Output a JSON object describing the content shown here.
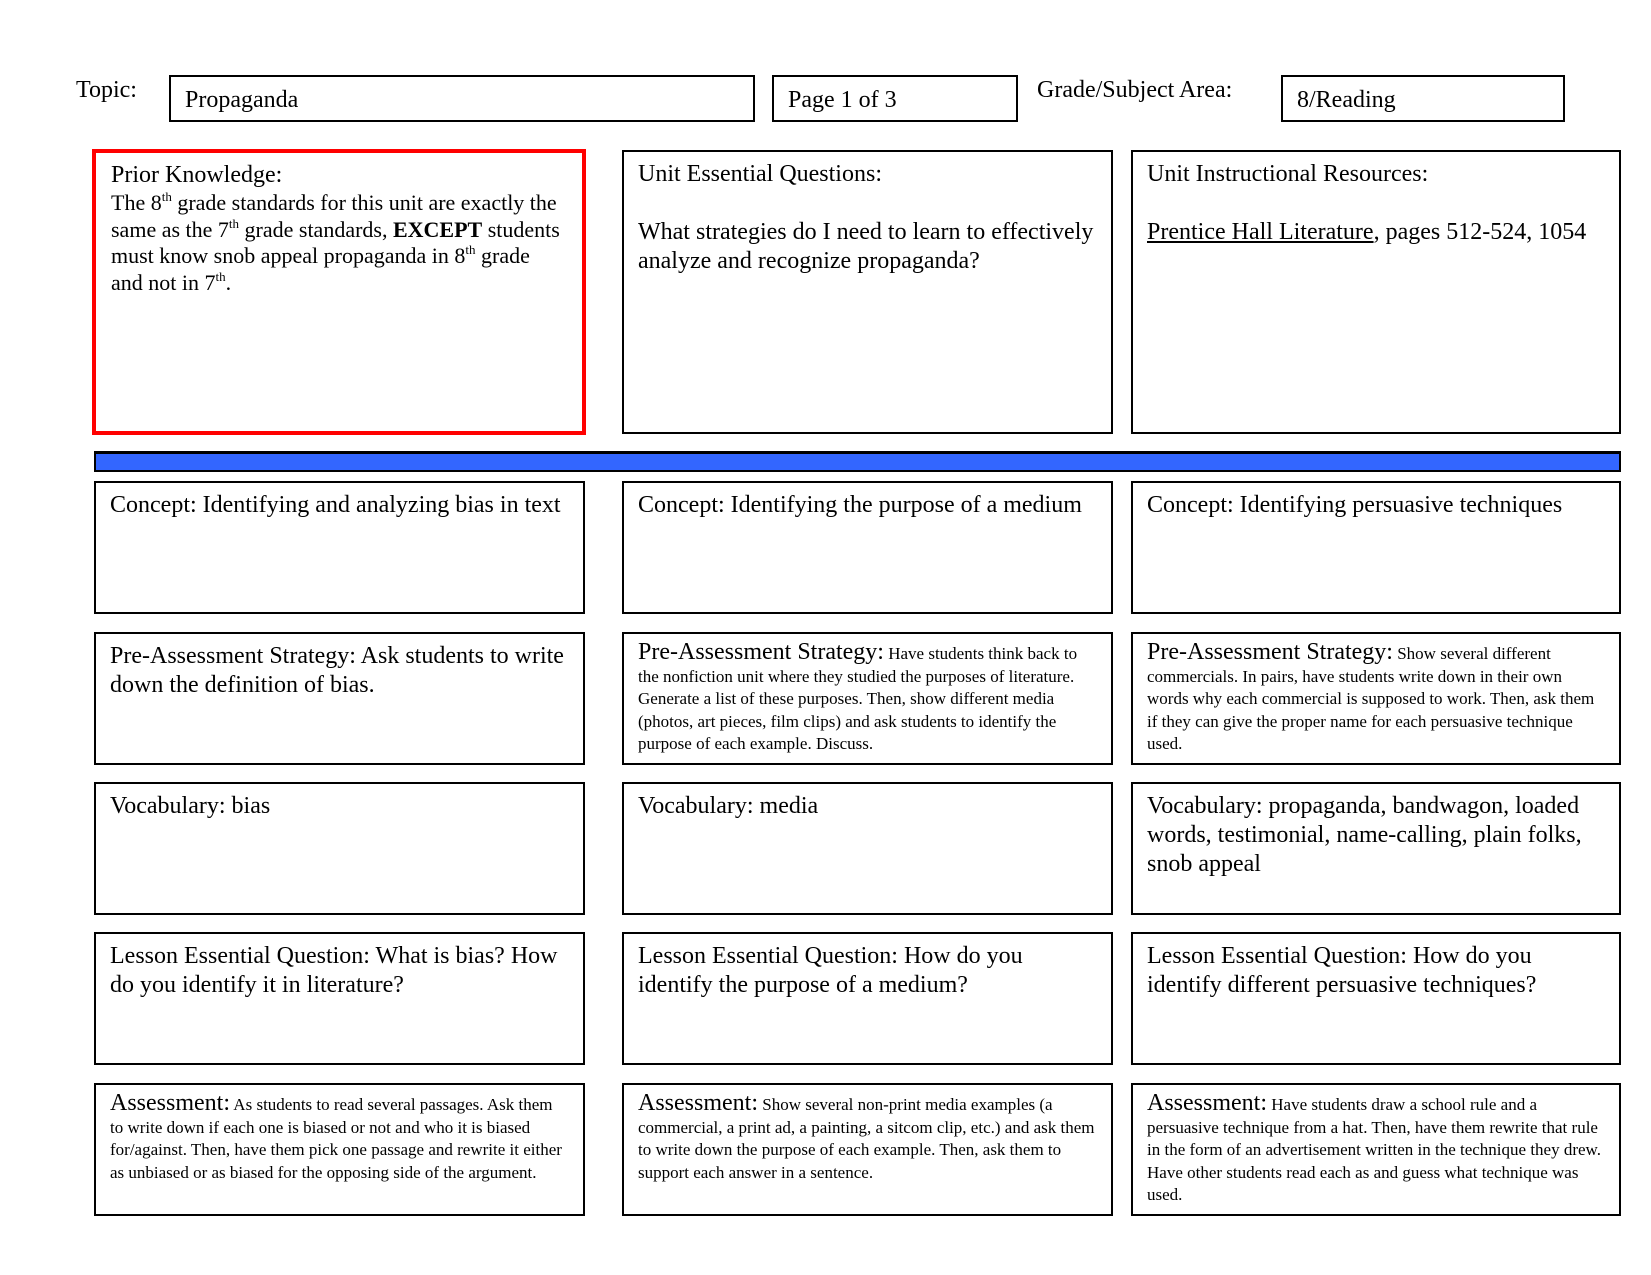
{
  "header": {
    "topic_label": "Topic:",
    "topic_value": "Propaganda",
    "page_value": "Page 1 of 3",
    "grade_label": "Grade/Subject Area:",
    "grade_value": "8/Reading"
  },
  "top_row": {
    "prior_knowledge": {
      "title": "Prior Knowledge:",
      "t1": "The 8",
      "s1": "th",
      "t2": " grade standards for this unit are exactly the same as the 7",
      "s2": "th",
      "t3": " grade standards, ",
      "bold": "EXCEPT",
      "t4": " students must know snob appeal propaganda in 8",
      "s3": "th",
      "t5": " grade and not in 7",
      "s4": "th",
      "t6": ".",
      "highlight_color": "#ff0000"
    },
    "unit_questions": {
      "title": "Unit Essential Questions:",
      "body": "What strategies do I need to learn to effectively analyze and recognize propaganda?"
    },
    "unit_resources": {
      "title": "Unit Instructional Resources:",
      "book": "Prentice Hall Literature",
      "rest": ", pages 512-524, 1054"
    }
  },
  "divider_color": "#3366ff",
  "columns": [
    {
      "concept": "Concept: Identifying and analyzing bias in text",
      "pre_assessment_lead": "Pre-Assessment Strategy: Ask students to write down the definition of bias.",
      "pre_assessment_body": "",
      "vocabulary": "Vocabulary: bias",
      "lesson_question": "Lesson Essential Question: What is bias? How do you identify it in literature?",
      "assessment_lead": "Assessment:",
      "assessment_body": " As students to read several passages.  Ask them to write down if each one is biased or not and who it is biased for/against.  Then, have them pick one passage and rewrite it either as unbiased or as biased for the opposing side of the argument."
    },
    {
      "concept": "Concept: Identifying the purpose of a medium",
      "pre_assessment_lead": "Pre-Assessment Strategy:",
      "pre_assessment_body": " Have students think back to the nonfiction unit where they studied the purposes of literature.  Generate a list of these purposes.  Then, show different media (photos, art pieces, film clips) and ask students to identify the purpose of each example.  Discuss.",
      "vocabulary": "Vocabulary: media",
      "lesson_question": "Lesson Essential Question:  How do you identify the purpose of a medium?",
      "assessment_lead": "Assessment:",
      "assessment_body": " Show several non-print media examples (a commercial, a print ad, a painting, a sitcom clip, etc.) and ask them to write down the purpose of each example.  Then, ask them to support each answer in a sentence."
    },
    {
      "concept": "Concept: Identifying persuasive techniques",
      "pre_assessment_lead": "Pre-Assessment Strategy:",
      "pre_assessment_body": " Show several different commercials.  In pairs, have students write down in their own words why each commercial is supposed to work.  Then, ask them if they can give the proper name for each persuasive technique used.",
      "vocabulary": "Vocabulary: propaganda, bandwagon, loaded words, testimonial, name-calling, plain folks, snob appeal",
      "lesson_question": "Lesson Essential Question:  How do you identify different persuasive techniques?",
      "assessment_lead": "Assessment:",
      "assessment_body": " Have students draw a school rule and a persuasive technique from a hat.  Then, have them rewrite that rule in the form of an advertisement written in the technique they drew.  Have other students read each as and guess what technique was used."
    }
  ]
}
